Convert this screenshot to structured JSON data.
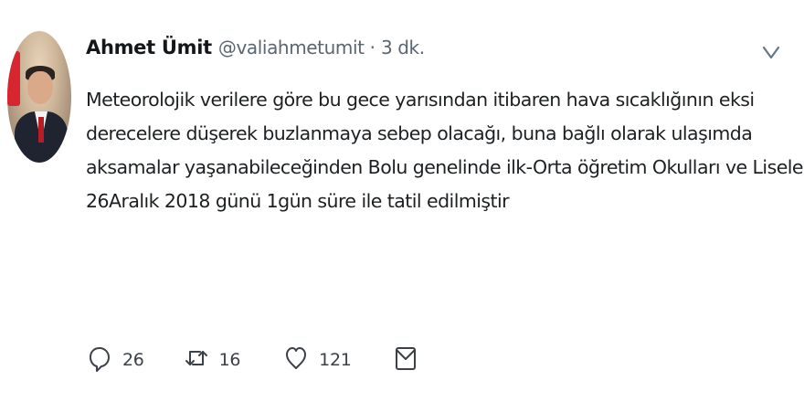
{
  "tweet": {
    "author": {
      "name": "Ahmet Ümit",
      "handle": "@valiahmetumit",
      "separator": "·",
      "time": "3 dk."
    },
    "text_lines": [
      "Meteorolojik verilere göre bu gece yarısından itibaren hava sıcaklığının eksi",
      "derecelere düşerek buzlanmaya sebep olacağı, buna bağlı olarak ulaşımda",
      "aksamalar yaşanabileceğinden Bolu genelinde ilk-Orta öğretim Okulları ve Liseler",
      "26Aralık 2018 günü 1gün süre ile tatil edilmiştir"
    ],
    "actions": {
      "replies": "26",
      "retweets": "16",
      "likes": "121"
    }
  },
  "icons": {
    "avatar": "avatar-photo",
    "caret": "chevron-down-icon",
    "reply": "reply-icon",
    "retweet": "retweet-icon",
    "like": "heart-icon",
    "dm": "direct-message-icon"
  },
  "colors": {
    "text": "#14171a",
    "secondary": "#5a6670",
    "icon": "#3b4147"
  }
}
